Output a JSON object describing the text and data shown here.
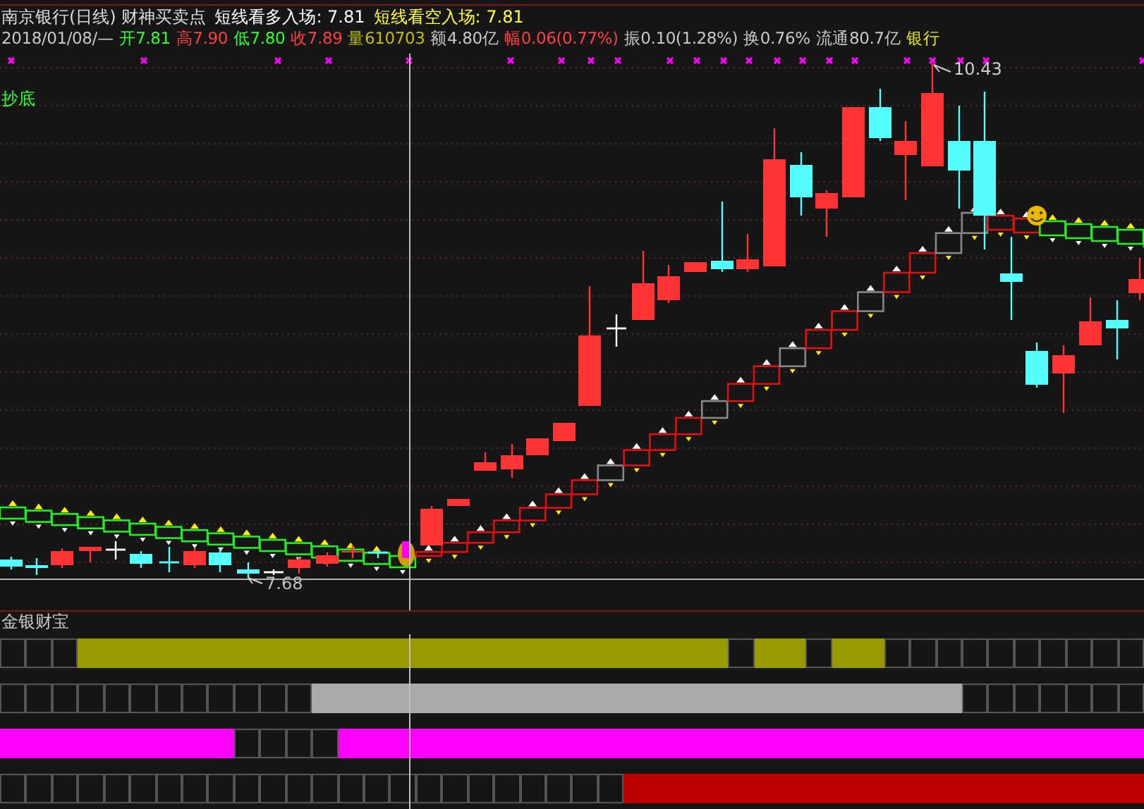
{
  "header": {
    "title": "南京银行(日线) 财神买卖点",
    "signals": [
      {
        "text": "短线看多入场: 7.81",
        "kind": "long"
      },
      {
        "text": "短线看空入场: 7.81",
        "kind": "short"
      }
    ]
  },
  "quote": [
    {
      "text": "2018/01/08/—",
      "kind": "neutral"
    },
    {
      "text": "开7.81",
      "kind": "down"
    },
    {
      "text": "高7.90",
      "kind": "up"
    },
    {
      "text": "低7.80",
      "kind": "down"
    },
    {
      "text": "收7.89",
      "kind": "up"
    },
    {
      "text": "量610703",
      "kind": "volume"
    },
    {
      "text": "额4.80亿",
      "kind": "neutral"
    },
    {
      "text": "幅0.06(0.77%)",
      "kind": "up"
    },
    {
      "text": "振0.10(1.28%)",
      "kind": "neutral"
    },
    {
      "text": "换0.76%",
      "kind": "neutral"
    },
    {
      "text": "流通80.7亿",
      "kind": "neutral"
    },
    {
      "text": "银行",
      "kind": "sector"
    }
  ],
  "chart": {
    "signal_label": "抄底",
    "high_label": "10.43",
    "low_label": "7.68"
  },
  "indicator": {
    "title": "金银财宝",
    "rows": [
      {
        "color": "#999900",
        "cells": [
          false,
          false,
          false,
          true,
          true,
          true,
          true,
          true,
          true,
          true,
          true,
          true,
          true,
          true,
          true,
          true,
          true,
          true,
          true,
          true,
          true,
          true,
          true,
          true,
          true,
          true,
          true,
          true,
          false,
          true,
          true,
          false,
          true,
          true,
          false,
          false,
          false,
          false,
          false,
          false,
          false,
          false,
          false,
          false
        ]
      },
      {
        "color": "#aaaaaa",
        "cells": [
          false,
          false,
          false,
          false,
          false,
          false,
          false,
          false,
          false,
          false,
          false,
          false,
          true,
          true,
          true,
          true,
          true,
          true,
          true,
          true,
          true,
          true,
          true,
          true,
          true,
          true,
          true,
          true,
          true,
          true,
          true,
          true,
          true,
          true,
          true,
          true,
          true,
          false,
          false,
          false,
          false,
          false,
          false,
          false
        ]
      },
      {
        "color": "#ff00ff",
        "cells": [
          true,
          true,
          true,
          true,
          true,
          true,
          true,
          true,
          true,
          false,
          false,
          false,
          false,
          true,
          true,
          true,
          true,
          true,
          true,
          true,
          true,
          true,
          true,
          true,
          true,
          true,
          true,
          true,
          true,
          true,
          true,
          true,
          true,
          true,
          true,
          true,
          true,
          true,
          true,
          true,
          true,
          true,
          true,
          true
        ]
      },
      {
        "color": "#bb0000",
        "cells": [
          false,
          false,
          false,
          false,
          false,
          false,
          false,
          false,
          false,
          false,
          false,
          false,
          false,
          false,
          false,
          false,
          false,
          false,
          false,
          false,
          false,
          false,
          false,
          false,
          true,
          true,
          true,
          true,
          true,
          true,
          true,
          true,
          true,
          true,
          true,
          true,
          true,
          true,
          true,
          true,
          true,
          true,
          true,
          true
        ]
      }
    ]
  }
}
